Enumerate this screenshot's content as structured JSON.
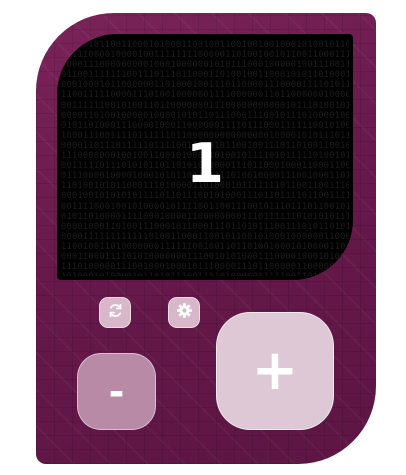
{
  "counter": {
    "value": "1"
  },
  "buttons": {
    "minus_label": "-",
    "plus_label": "+",
    "reset_icon": "refresh-icon",
    "settings_icon": "gear-icon"
  },
  "colors": {
    "device_body": "#6b1d4d",
    "screen": "#000000",
    "plus_button": "#dec8d5",
    "minus_button": "#b98aa6",
    "small_button": "#d8b7c8"
  }
}
